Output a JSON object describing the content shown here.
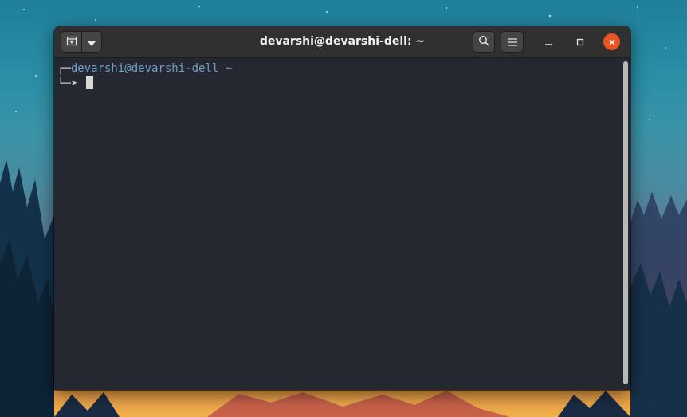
{
  "window": {
    "title": "devarshi@devarshi-dell: ~"
  },
  "header_buttons": {
    "new_tab_icon": "new-tab-icon",
    "dropdown_icon": "chevron-down-icon",
    "search_icon": "search-icon",
    "menu_icon": "hamburger-menu-icon"
  },
  "window_controls": {
    "minimize_icon": "minimize-icon",
    "maximize_icon": "maximize-icon",
    "close_icon": "close-icon",
    "close_color": "#e95420"
  },
  "terminal": {
    "prompt_frame_top": "┌─",
    "user": "devarshi",
    "at": "@",
    "host": "devarshi-dell",
    "path": "~",
    "prompt_frame_bottom": "└─",
    "prompt_arrow": "➤",
    "background_color": "#262831",
    "prompt_color": "#6d9fc8"
  }
}
